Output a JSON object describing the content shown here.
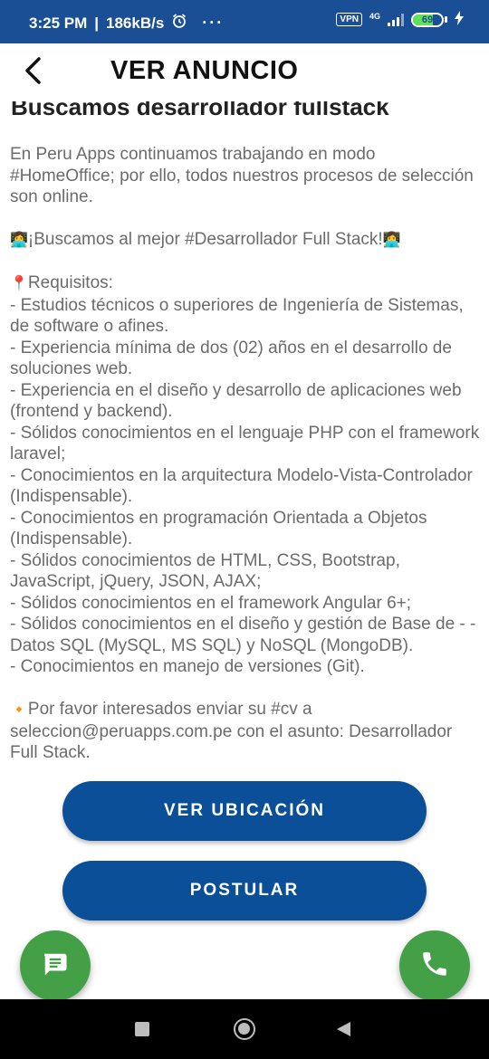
{
  "status": {
    "time": "3:25 PM",
    "speed": "186kB/s",
    "vpn": "VPN",
    "network": "4G",
    "battery": "69"
  },
  "header": {
    "title": "VER ANUNCIO"
  },
  "ad": {
    "heading": "Buscamos desarrollador fullstack",
    "intro": "En Peru Apps continuamos trabajando en modo #HomeOffice; por ello, todos nuestros procesos de selección son online.",
    "tagline": "¡Buscamos al mejor #Desarrollador Full Stack!",
    "requirements_title": "Requisitos:",
    "requirements": [
      "- Estudios técnicos o superiores de Ingeniería de Sistemas, de software o afines.",
      "- Experiencia mínima de dos (02) años en el desarrollo de soluciones web.",
      "- Experiencia en el diseño y desarrollo de aplicaciones web (frontend y backend).",
      "- Sólidos conocimientos en el lenguaje PHP con el framework laravel;",
      "- Conocimientos en la arquitectura Modelo-Vista-Controlador (Indispensable).",
      "- Conocimientos en programación Orientada a Objetos (Indispensable).",
      "- Sólidos conocimientos de HTML, CSS, Bootstrap, JavaScript, jQuery, JSON, AJAX;",
      "- Sólidos conocimientos en el framework Angular 6+;",
      "- Sólidos conocimientos en el diseño y gestión de Base de - - Datos SQL (MySQL, MS SQL) y NoSQL (MongoDB).",
      "- Conocimientos en manejo de versiones (Git)."
    ],
    "contact": "Por favor interesados enviar su #cv a seleccion@peruapps.com.pe con el asunto: Desarrollador Full Stack."
  },
  "actions": {
    "location_label": "VER UBICACIÓN",
    "apply_label": "POSTULAR"
  },
  "icons": {
    "back": "arrow-left",
    "chat": "chat-bubble",
    "phone": "phone",
    "accent": "#0b4f99",
    "fab_color": "#43a047"
  }
}
